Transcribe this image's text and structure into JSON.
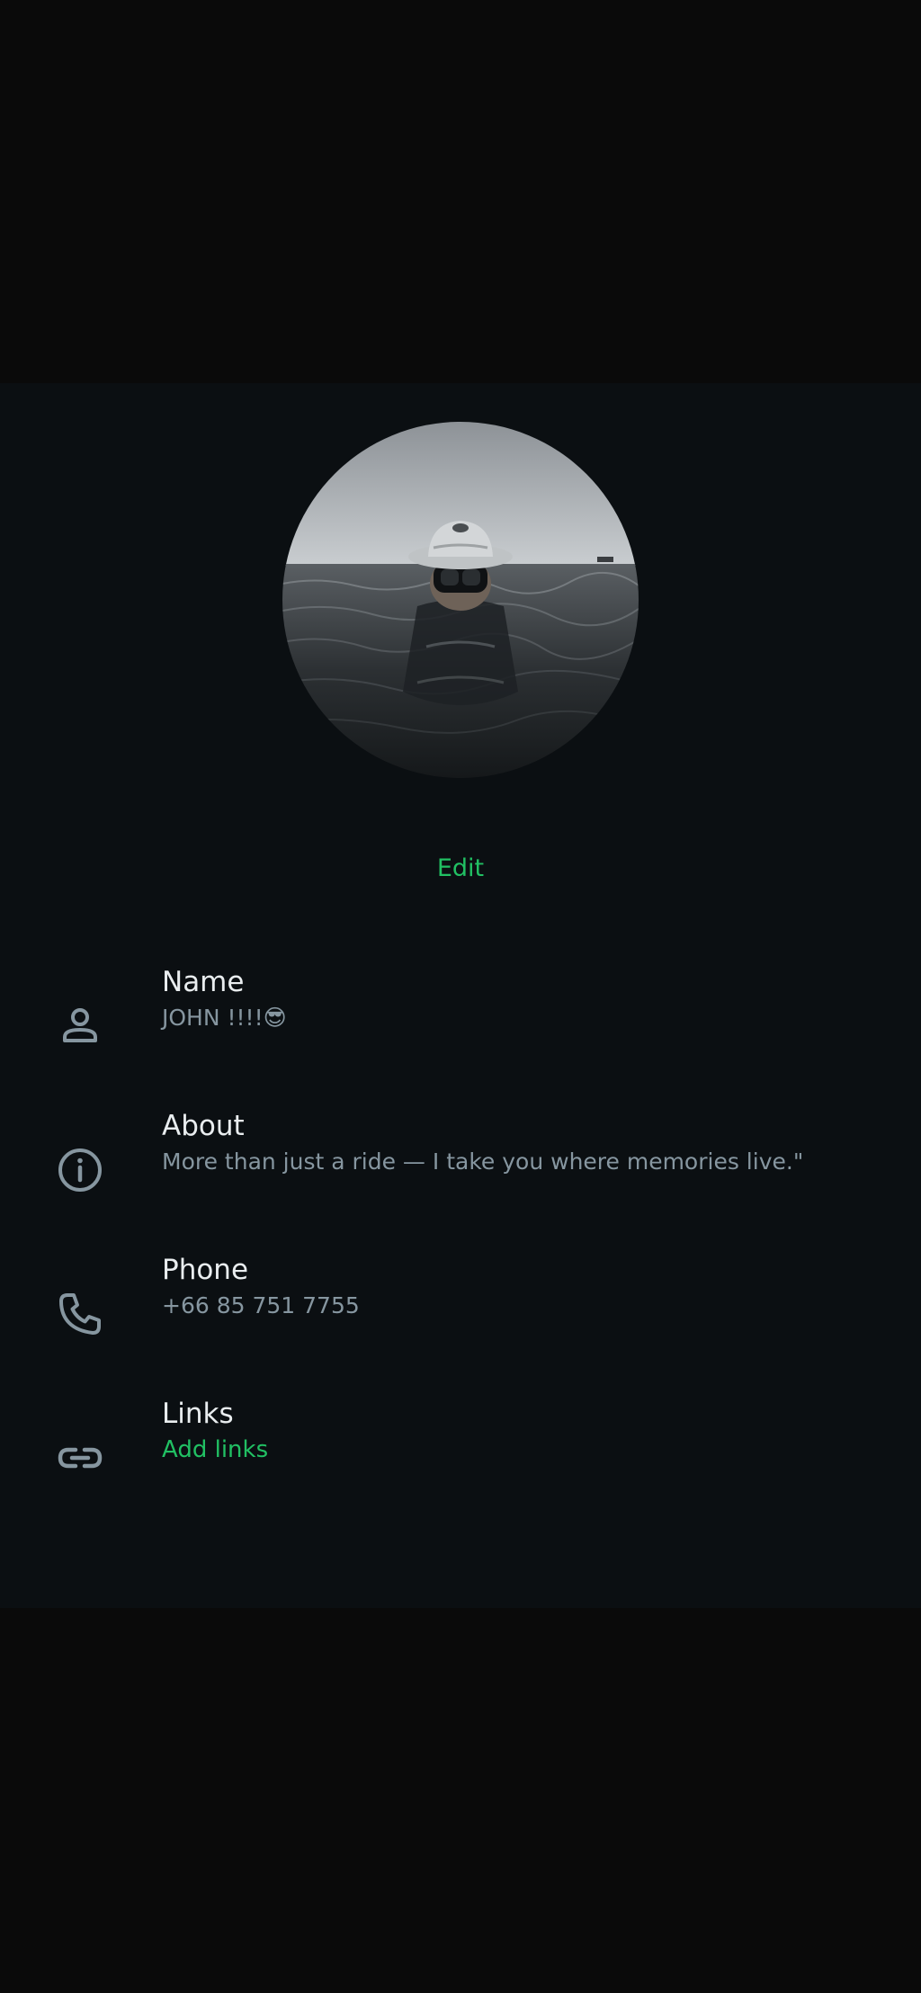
{
  "profile": {
    "edit_label": "Edit",
    "fields": [
      {
        "label": "Name",
        "value": "JOHN !!!!😎",
        "icon": "person-icon"
      },
      {
        "label": "About",
        "value": "More than just a ride — I take you where memories live.\"",
        "icon": "info-icon"
      },
      {
        "label": "Phone",
        "value": "+66 85 751 7755",
        "icon": "phone-icon"
      },
      {
        "label": "Links",
        "value": "Add links",
        "icon": "link-icon"
      }
    ]
  },
  "colors": {
    "accent": "#21c063",
    "background": "#0b0f12",
    "primary_text": "#e9edef",
    "secondary_text": "#8696a0",
    "icon": "#8696a0"
  }
}
